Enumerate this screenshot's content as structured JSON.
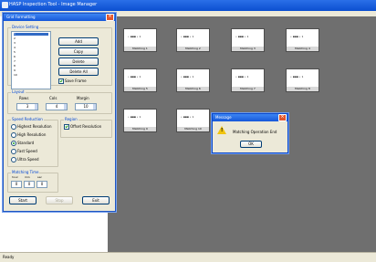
{
  "app": {
    "title": "HASP Inspection Tool - Image Manager"
  },
  "status": {
    "text": "Ready"
  },
  "panel": {
    "title": "Grid Formatting",
    "group_device": "Device Setting",
    "list_items": [
      "1",
      "2",
      "3",
      "4",
      "5",
      "6",
      "7",
      "8",
      "9",
      "10"
    ],
    "btn_add": "Add",
    "btn_copy": "Copy",
    "btn_delete": "Delete",
    "btn_delete_all": "Delete All",
    "check_save_frame": "Save Frame",
    "group_layout": "Layout",
    "layout_labels": [
      "Rows",
      "Cols",
      "Margin"
    ],
    "layout_values": [
      "3",
      "4",
      "10"
    ],
    "group_speed": "Speed Reduction",
    "radio_options": [
      "Highest Resolution",
      "High Resolution",
      "Standard",
      "Fast Speed",
      "Ultra Speed"
    ],
    "group_region": "Region",
    "check_region": "Offset Resolution",
    "group_time": "Matching Time",
    "time_labels": [
      "hour",
      "min",
      "sec"
    ],
    "time_values": [
      "0",
      "0",
      "0"
    ],
    "btn_start": "Start",
    "btn_stop": "Stop",
    "btn_exit": "Exit"
  },
  "thumbnails": [
    "Matching 1",
    "Matching 2",
    "Matching 3",
    "Matching 4",
    "Matching 5",
    "Matching 6",
    "Matching 7",
    "Matching 8",
    "Matching 9",
    "Matching 10"
  ],
  "thumb_inner": "• ▪▪▪ • 1",
  "dialog": {
    "title": "Message",
    "message": "Matching Operation End",
    "ok": "OK"
  }
}
